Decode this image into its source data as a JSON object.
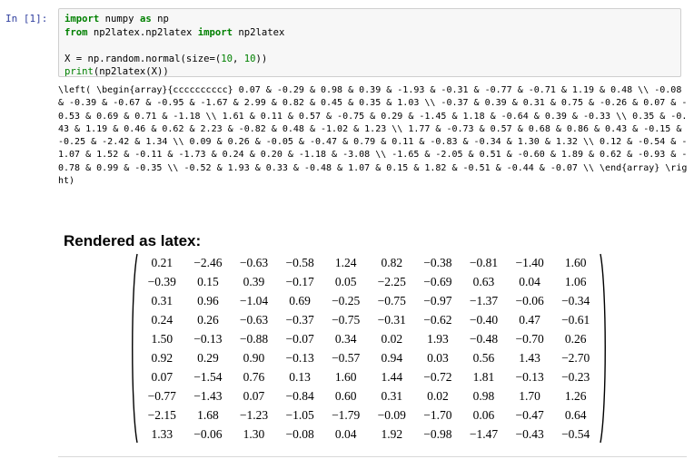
{
  "prompt": "In [1]:",
  "code": {
    "l1_kw1": "import",
    "l1_mod": " numpy ",
    "l1_kw2": "as",
    "l1_alias": " np",
    "l2_kw1": "from",
    "l2_mod": " np2latex.np2latex ",
    "l2_kw2": "import",
    "l2_name": " np2latex",
    "l4_pre": "X = np.random.normal(size=(",
    "l4_n1": "10",
    "l4_mid": ", ",
    "l4_n2": "10",
    "l4_post": "))",
    "l5_fn": "print",
    "l5_rest": "(np2latex(X))"
  },
  "output_text": "\\left( \\begin{array}{cccccccccc} 0.07 & -0.29 & 0.98 & 0.39 & -1.93 & -0.31 & -0.77 & -0.71 & 1.19 & 0.48 \\\\ -0.08 & -0.39 & -0.67 & -0.95 & -1.67 & 2.99 & 0.82 & 0.45 & 0.35 & 1.03 \\\\ -0.37 & 0.39 & 0.31 & 0.75 & -0.26 & 0.07 & -0.53 & 0.69 & 0.71 & -1.18 \\\\ 1.61 & 0.11 & 0.57 & -0.75 & 0.29 & -1.45 & 1.18 & -0.64 & 0.39 & -0.33 \\\\ 0.35 & -0.43 & 1.19 & 0.46 & 0.62 & 2.23 & -0.82 & 0.48 & -1.02 & 1.23 \\\\ 1.77 & -0.73 & 0.57 & 0.68 & 0.86 & 0.43 & -0.15 & -0.25 & -2.42 & 1.34 \\\\ 0.09 & 0.26 & -0.05 & -0.47 & 0.79 & 0.11 & -0.83 & -0.34 & 1.30 & 1.32 \\\\ 0.12 & -0.54 & -1.07 & 1.52 & -0.11 & -1.73 & 0.24 & 0.20 & -1.18 & -3.08 \\\\ -1.65 & -2.05 & 0.51 & -0.60 & 1.89 & 0.62 & -0.93 & -0.78 & 0.99 & -0.35 \\\\ -0.52 & 1.93 & 0.33 & -0.48 & 1.07 & 0.15 & 1.82 & -0.51 & -0.44 & -0.07 \\\\ \\end{array} \\right)",
  "heading": "Rendered as latex:",
  "matrix": [
    [
      "0.21",
      "−2.46",
      "−0.63",
      "−0.58",
      "1.24",
      "0.82",
      "−0.38",
      "−0.81",
      "−1.40",
      "1.60"
    ],
    [
      "−0.39",
      "0.15",
      "0.39",
      "−0.17",
      "0.05",
      "−2.25",
      "−0.69",
      "0.63",
      "0.04",
      "1.06"
    ],
    [
      "0.31",
      "0.96",
      "−1.04",
      "0.69",
      "−0.25",
      "−0.75",
      "−0.97",
      "−1.37",
      "−0.06",
      "−0.34"
    ],
    [
      "0.24",
      "0.26",
      "−0.63",
      "−0.37",
      "−0.75",
      "−0.31",
      "−0.62",
      "−0.40",
      "0.47",
      "−0.61"
    ],
    [
      "1.50",
      "−0.13",
      "−0.88",
      "−0.07",
      "0.34",
      "0.02",
      "1.93",
      "−0.48",
      "−0.70",
      "0.26"
    ],
    [
      "0.92",
      "0.29",
      "0.90",
      "−0.13",
      "−0.57",
      "0.94",
      "0.03",
      "0.56",
      "1.43",
      "−2.70"
    ],
    [
      "0.07",
      "−1.54",
      "0.76",
      "0.13",
      "1.60",
      "1.44",
      "−0.72",
      "1.81",
      "−0.13",
      "−0.23"
    ],
    [
      "−0.77",
      "−1.43",
      "0.07",
      "−0.84",
      "0.60",
      "0.31",
      "0.02",
      "0.98",
      "1.70",
      "1.26"
    ],
    [
      "−2.15",
      "1.68",
      "−1.23",
      "−1.05",
      "−1.79",
      "−0.09",
      "−1.70",
      "0.06",
      "−0.47",
      "0.64"
    ],
    [
      "1.33",
      "−0.06",
      "1.30",
      "−0.08",
      "0.04",
      "1.92",
      "−0.98",
      "−1.47",
      "−0.43",
      "−0.54"
    ]
  ],
  "colors": {
    "prompt": "#303f9f",
    "keyword": "#008000",
    "input_bg": "#f7f7f7",
    "input_border": "#cfcfcf"
  }
}
